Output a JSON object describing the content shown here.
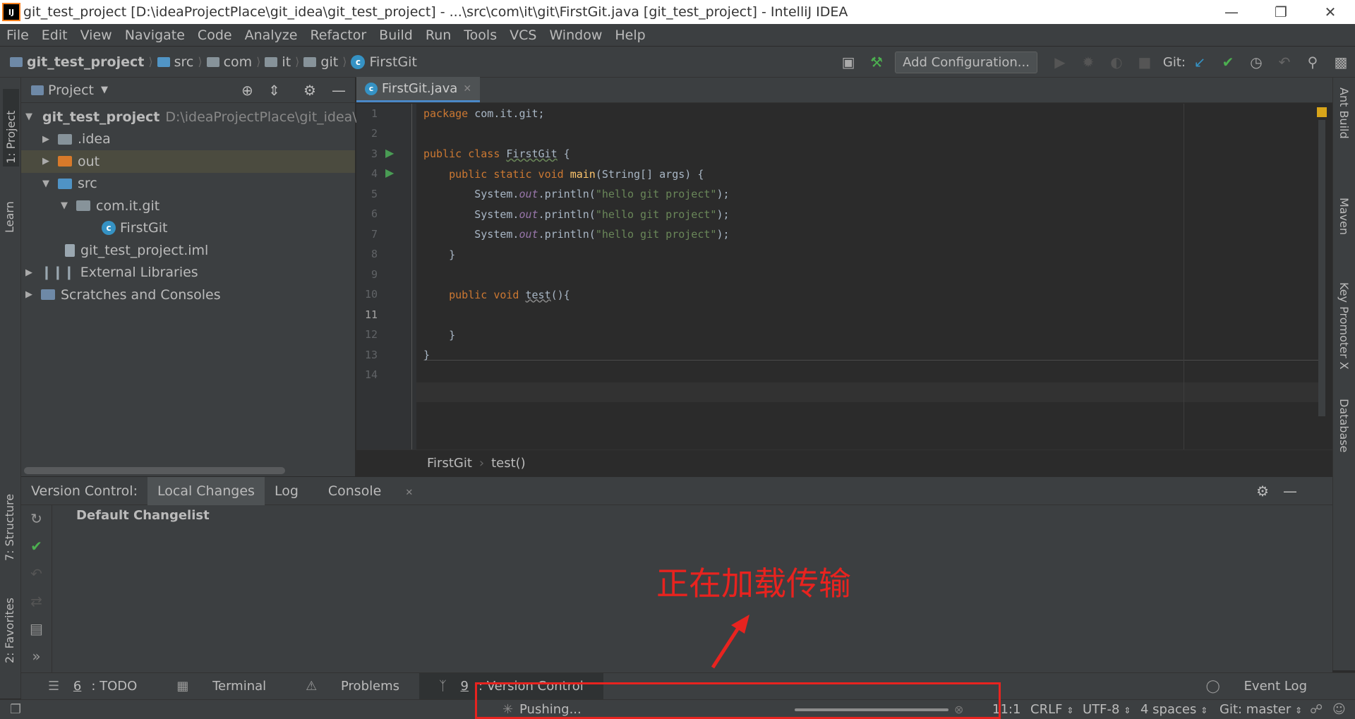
{
  "window": {
    "title": "git_test_project [D:\\ideaProjectPlace\\git_idea\\git_test_project] - ...\\src\\com\\it\\git\\FirstGit.java [git_test_project] - IntelliJ IDEA",
    "logo_text": "IJ"
  },
  "menu": [
    "File",
    "Edit",
    "View",
    "Navigate",
    "Code",
    "Analyze",
    "Refactor",
    "Build",
    "Run",
    "Tools",
    "VCS",
    "Window",
    "Help"
  ],
  "breadcrumb": [
    "git_test_project",
    "src",
    "com",
    "it",
    "git",
    "FirstGit"
  ],
  "toolbar": {
    "add_configuration": "Add Configuration...",
    "git_label": "Git:"
  },
  "left_tabs": {
    "project": "1: Project",
    "learn": "Learn",
    "structure": "7: Structure",
    "favorites": "2: Favorites"
  },
  "right_tabs": {
    "ant": "Ant Build",
    "maven": "Maven",
    "key_promoter": "Key Promoter X",
    "database": "Database"
  },
  "project_panel": {
    "title": "Project",
    "tree": [
      {
        "label": "git_test_project",
        "path": "D:\\ideaProjectPlace\\git_idea\\gi"
      },
      {
        "label": ".idea"
      },
      {
        "label": "out"
      },
      {
        "label": "src"
      },
      {
        "label": "com.it.git"
      },
      {
        "label": "FirstGit"
      },
      {
        "label": "git_test_project.iml"
      },
      {
        "label": "External Libraries"
      },
      {
        "label": "Scratches and Consoles"
      }
    ]
  },
  "editor": {
    "tab": "FirstGit.java",
    "line_numbers": [
      "1",
      "2",
      "3",
      "4",
      "5",
      "6",
      "7",
      "8",
      "9",
      "10",
      "11",
      "12",
      "13",
      "14"
    ],
    "code": {
      "l1_kw": "package",
      "l1_rest": " com.it.git;",
      "l3_kw": "public class",
      "l3_name": "FirstGit",
      "l3_rest": " {",
      "l4_kw": "public static void",
      "l4_fn": "main",
      "l4_rest": "(String[] args) {",
      "print_obj": "System.",
      "print_out": "out",
      "print_call": ".println(",
      "print_str": "\"hello git project\"",
      "print_end": ");",
      "l8": "}",
      "l10_kw": "public void",
      "l10_fn": "test",
      "l10_rest": "(){",
      "l12": "}",
      "l13": "}"
    },
    "breadcrumb": [
      "FirstGit",
      "test()"
    ]
  },
  "version_control": {
    "label": "Version Control:",
    "tabs": [
      "Local Changes",
      "Log",
      "Console"
    ],
    "changelist": "Default Changelist"
  },
  "bottom_tabs": [
    {
      "num": "6",
      "label": ": TODO"
    },
    {
      "label": "Terminal"
    },
    {
      "label": "Problems"
    },
    {
      "num": "9",
      "label": ": Version Control"
    }
  ],
  "event_log": "Event Log",
  "status": {
    "task": "Pushing...",
    "position": "11:1",
    "line_sep": "CRLF",
    "encoding": "UTF-8",
    "indent": "4 spaces",
    "branch": "Git: master"
  },
  "annotation": {
    "text": "正在加载传输"
  },
  "colors": {
    "annotation": "#e8231f",
    "accent": "#4a88c7"
  }
}
